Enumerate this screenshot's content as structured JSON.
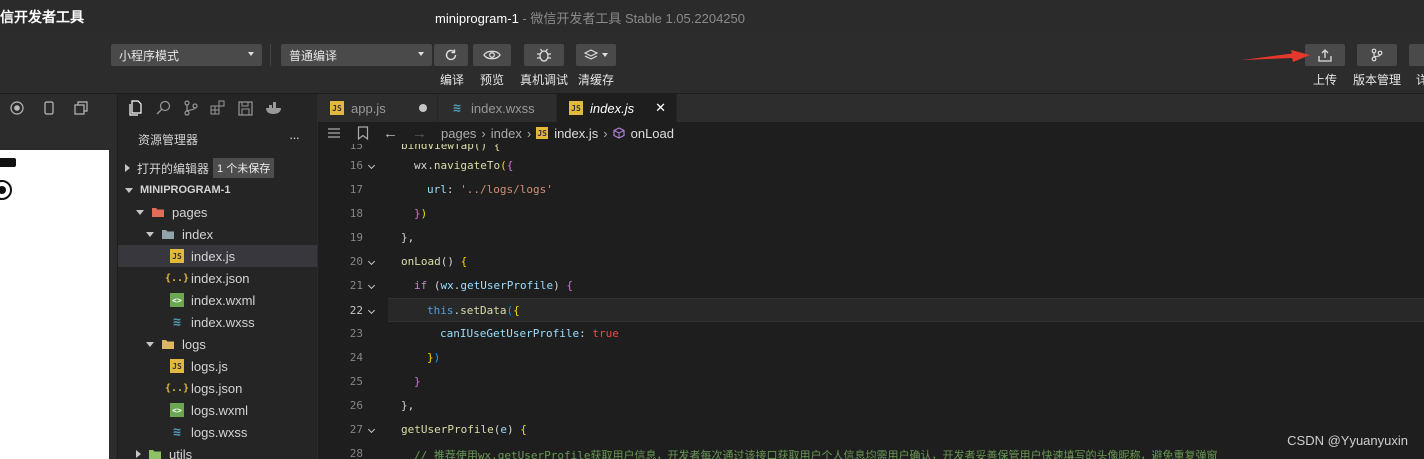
{
  "window": {
    "app_title": "微信开发者工具",
    "project": "miniprogram-1",
    "sep": " - ",
    "subtitle": "微信开发者工具 Stable 1.05.2204250"
  },
  "toolbar": {
    "mode_select": "小程序模式",
    "compile_select": "普通编译",
    "compile_label": "编译",
    "preview_label": "预览",
    "debug_label": "真机调试",
    "cache_label": "清缓存",
    "upload_label": "上传",
    "version_label": "版本管理",
    "details_label": "详"
  },
  "explorer": {
    "title": "资源管理器",
    "more": "···",
    "open_editors": "打开的编辑器",
    "unsaved_badge": "1 个未保存",
    "project_root": "MINIPROGRAM-1",
    "tree": [
      {
        "label": "pages",
        "icon": "folder-red",
        "depth": 1,
        "twisty": "down"
      },
      {
        "label": "index",
        "icon": "folder-open",
        "depth": 2,
        "twisty": "down"
      },
      {
        "label": "index.js",
        "icon": "js",
        "depth": 3,
        "selected": true
      },
      {
        "label": "index.json",
        "icon": "json",
        "depth": 3
      },
      {
        "label": "index.wxml",
        "icon": "wxml",
        "depth": 3
      },
      {
        "label": "index.wxss",
        "icon": "wxss",
        "depth": 3
      },
      {
        "label": "logs",
        "icon": "folder-yellow",
        "depth": 2,
        "twisty": "down"
      },
      {
        "label": "logs.js",
        "icon": "js",
        "depth": 3
      },
      {
        "label": "logs.json",
        "icon": "json",
        "depth": 3
      },
      {
        "label": "logs.wxml",
        "icon": "wxml",
        "depth": 3
      },
      {
        "label": "logs.wxss",
        "icon": "wxss",
        "depth": 3
      },
      {
        "label": "utils",
        "icon": "folder-green",
        "depth": 1,
        "twisty": "right"
      }
    ]
  },
  "tabs": [
    {
      "label": "app.js",
      "icon": "js",
      "modified": true
    },
    {
      "label": "index.wxss",
      "icon": "wxss"
    },
    {
      "label": "index.js",
      "icon": "js",
      "active": true,
      "close": "✕"
    }
  ],
  "breadcrumb": {
    "items": [
      "pages",
      "index",
      "index.js",
      "onLoad"
    ],
    "sep": "›"
  },
  "editor": {
    "current_line": 22,
    "partial_top": "bindViewTap() {",
    "lines": [
      {
        "n": 16,
        "fold": true,
        "indent": 1,
        "parts": [
          [
            "wx",
            "#d4d4d4"
          ],
          [
            ".",
            "#d4d4d4"
          ],
          [
            "navigateTo",
            "#dcdcaa"
          ],
          [
            "(",
            "#ffd700"
          ],
          [
            "{",
            "#da70d6"
          ]
        ]
      },
      {
        "n": 17,
        "indent": 2,
        "parts": [
          [
            "url",
            "#9cdcfe"
          ],
          [
            ": ",
            "#d4d4d4"
          ],
          [
            "'../logs/logs'",
            "#ce9178"
          ]
        ]
      },
      {
        "n": 18,
        "indent": 1,
        "parts": [
          [
            "}",
            "#da70d6"
          ],
          [
            ")",
            "#ffd700"
          ]
        ]
      },
      {
        "n": 19,
        "indent": 0,
        "parts": [
          [
            "},",
            "#d4d4d4"
          ]
        ]
      },
      {
        "n": 20,
        "fold": true,
        "indent": 0,
        "parts": [
          [
            "onLoad",
            "#dcdcaa"
          ],
          [
            "() ",
            "#d4d4d4"
          ],
          [
            "{",
            "#ffd700"
          ]
        ]
      },
      {
        "n": 21,
        "fold": true,
        "indent": 1,
        "parts": [
          [
            "if",
            "#c586c0"
          ],
          [
            " (",
            "#d4d4d4"
          ],
          [
            "wx",
            "#9cdcfe"
          ],
          [
            ".",
            "#d4d4d4"
          ],
          [
            "getUserProfile",
            "#9cdcfe"
          ],
          [
            ") ",
            "#d4d4d4"
          ],
          [
            "{",
            "#da70d6"
          ]
        ]
      },
      {
        "n": 22,
        "fold": true,
        "indent": 2,
        "parts": [
          [
            "this",
            "#569cd6"
          ],
          [
            ".",
            "#d4d4d4"
          ],
          [
            "setData",
            "#dcdcaa"
          ],
          [
            "(",
            "#179fff"
          ],
          [
            "{",
            "#ffd700"
          ]
        ]
      },
      {
        "n": 23,
        "indent": 3,
        "parts": [
          [
            "canIUseGetUserProfile",
            "#9cdcfe"
          ],
          [
            ": ",
            "#d4d4d4"
          ],
          [
            "true",
            "#f44747"
          ]
        ]
      },
      {
        "n": 24,
        "indent": 2,
        "parts": [
          [
            "}",
            "#ffd700"
          ],
          [
            ")",
            "#179fff"
          ]
        ]
      },
      {
        "n": 25,
        "indent": 1,
        "parts": [
          [
            "}",
            "#da70d6"
          ]
        ]
      },
      {
        "n": 26,
        "indent": 0,
        "parts": [
          [
            "},",
            "#d4d4d4"
          ]
        ]
      },
      {
        "n": 27,
        "fold": true,
        "indent": 0,
        "parts": [
          [
            "getUserProfile",
            "#dcdcaa"
          ],
          [
            "(",
            "#d4d4d4"
          ],
          [
            "e",
            "#9cdcfe"
          ],
          [
            ") ",
            "#d4d4d4"
          ],
          [
            "{",
            "#ffd700"
          ]
        ]
      },
      {
        "n": 28,
        "indent": 1,
        "parts": [
          [
            "// 推荐使用wx.getUserProfile获取用户信息，开发者每次通过该接口获取用户个人信息均需用户确认，开发者妥善保管用户快速填写的头像昵称，避免重复弹窗",
            "#6a9955"
          ]
        ]
      }
    ]
  },
  "watermark": "CSDN @Yyuanyuxin",
  "colors": {
    "accent_arrow": "#e5372b",
    "editor_bg": "#1e1e1e",
    "sidebar_bg": "#252526"
  }
}
